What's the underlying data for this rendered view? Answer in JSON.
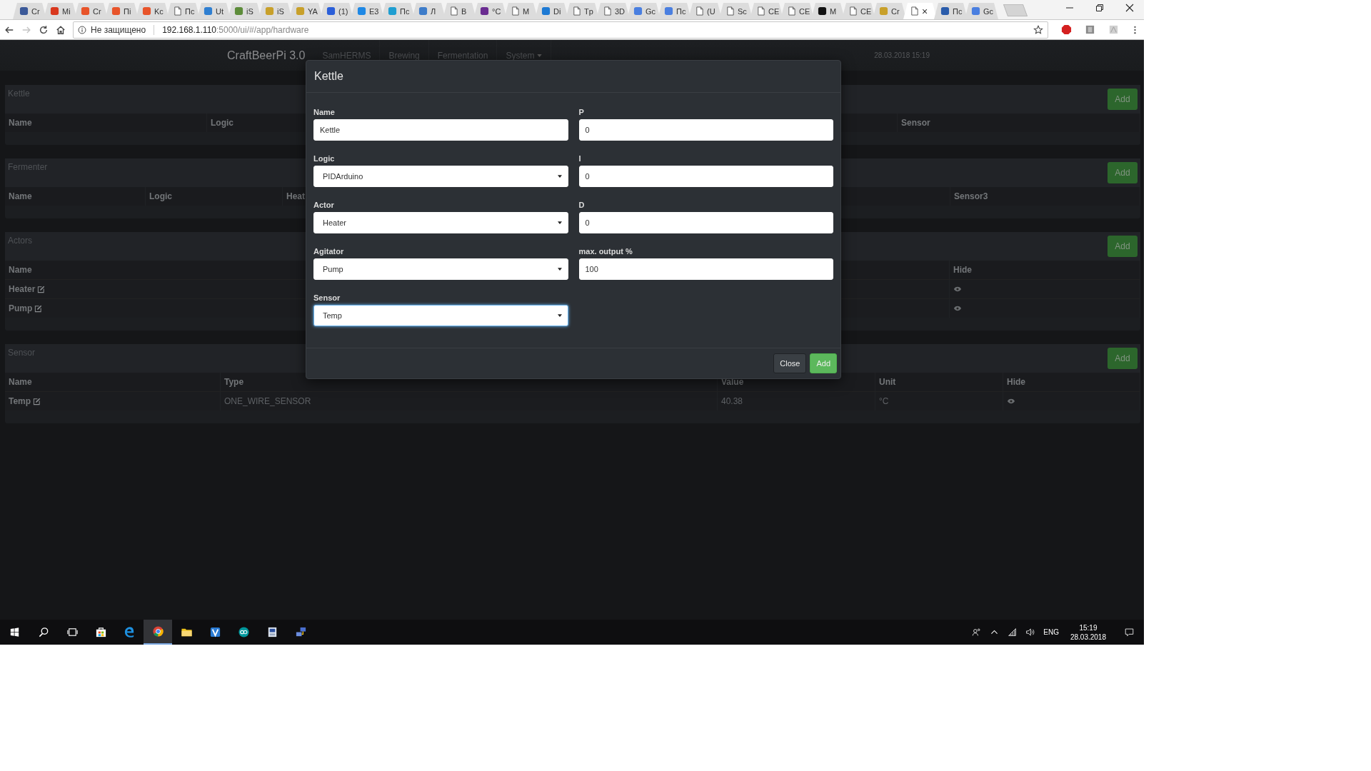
{
  "browser": {
    "tabs": [
      {
        "kind": "logo",
        "color": "#3b5998",
        "title": "Cr",
        "selected": false
      },
      {
        "kind": "logo",
        "color": "#d9381e",
        "title": "Mi",
        "selected": false
      },
      {
        "kind": "logo",
        "color": "#e8542a",
        "title": "Cr",
        "selected": false
      },
      {
        "kind": "logo",
        "color": "#e8542a",
        "title": "Пі",
        "selected": false
      },
      {
        "kind": "logo",
        "color": "#e8542a",
        "title": "Kc",
        "selected": false
      },
      {
        "kind": "doc",
        "title": "Пс",
        "selected": false
      },
      {
        "kind": "logo",
        "color": "#2f7fd1",
        "title": "Ut",
        "selected": false
      },
      {
        "kind": "logo",
        "color": "#5d8c3a",
        "title": "iS",
        "selected": false
      },
      {
        "kind": "logo",
        "color": "#c8a02a",
        "title": "iS",
        "selected": false
      },
      {
        "kind": "logo",
        "color": "#c8a02a",
        "title": "YA",
        "selected": false
      },
      {
        "kind": "logo",
        "color": "#2b5fd9",
        "title": "(1)",
        "selected": false
      },
      {
        "kind": "logo",
        "color": "#1e88e5",
        "title": "E3",
        "selected": false
      },
      {
        "kind": "logo",
        "color": "#1f9ed1",
        "title": "Пс",
        "selected": false
      },
      {
        "kind": "logo",
        "color": "#3d7cc9",
        "title": "Л",
        "selected": false
      },
      {
        "kind": "doc",
        "title": "B",
        "selected": false
      },
      {
        "kind": "logo",
        "color": "#6a2c91",
        "title": "°C",
        "selected": false
      },
      {
        "kind": "doc",
        "title": "M",
        "selected": false
      },
      {
        "kind": "logo",
        "color": "#1e7ad4",
        "title": "Di",
        "selected": false
      },
      {
        "kind": "doc",
        "title": "Tp",
        "selected": false
      },
      {
        "kind": "doc",
        "title": "3D",
        "selected": false
      },
      {
        "kind": "logo",
        "color": "#4a7fe0",
        "title": "Gc",
        "selected": false
      },
      {
        "kind": "logo",
        "color": "#4a7fe0",
        "title": "Пс",
        "selected": false
      },
      {
        "kind": "doc",
        "title": "(U",
        "selected": false
      },
      {
        "kind": "doc",
        "title": "Sc",
        "selected": false
      },
      {
        "kind": "doc",
        "title": "CE",
        "selected": false
      },
      {
        "kind": "doc",
        "title": "CE",
        "selected": false
      },
      {
        "kind": "logo",
        "color": "#111111",
        "title": "M",
        "selected": false
      },
      {
        "kind": "doc",
        "title": "CE",
        "selected": false
      },
      {
        "kind": "logo",
        "color": "#c8a02a",
        "title": "Cr",
        "selected": false
      },
      {
        "kind": "doc",
        "close": "×",
        "selected": true
      },
      {
        "kind": "logo",
        "color": "#2a5cab",
        "title": "Пс",
        "selected": false
      },
      {
        "kind": "logo",
        "color": "#4a7fe0",
        "title": "Gc",
        "selected": false
      }
    ]
  },
  "address_bar": {
    "security_label": "Не защищено",
    "url_host": "192.168.1.110",
    "url_rest": ":5000/ui/#/app/hardware",
    "forward_disabled": true
  },
  "navbar": {
    "brand": "CraftBeerPi 3.0",
    "items": [
      {
        "label": "SamHERMS",
        "dropdown": false
      },
      {
        "label": "Brewing",
        "dropdown": false
      },
      {
        "label": "Fermentation",
        "dropdown": false
      },
      {
        "label": "System",
        "dropdown": true
      }
    ],
    "datetime": "28.03.2018 15:19"
  },
  "panels": [
    {
      "title": "Kettle",
      "add_button": "Add",
      "columns": [
        "Name",
        "Logic",
        "Sensor"
      ]
    },
    {
      "title": "Fermenter",
      "add_button": "Add",
      "columns": [
        "Name",
        "Logic",
        "Heat",
        "Sensor3"
      ]
    },
    {
      "title": "Actors",
      "add_button": "Add",
      "columns": [
        "Name",
        "Hide"
      ],
      "rows": [
        {
          "cells": [
            "Heater"
          ]
        },
        {
          "cells": [
            "Pump"
          ]
        }
      ]
    },
    {
      "title": "Sensor",
      "add_button": "Add",
      "columns": [
        "Name",
        "Type",
        "Value",
        "Unit",
        "Hide"
      ],
      "rows": [
        {
          "cells": [
            "Temp",
            "ONE_WIRE_SENSOR",
            "40.38",
            "°C"
          ]
        }
      ]
    }
  ],
  "modal": {
    "title": "Kettle",
    "left_column": [
      {
        "label": "Name",
        "kind": "text",
        "value": "Kettle",
        "focused": false
      },
      {
        "label": "Logic",
        "kind": "select",
        "value": "PIDArduino",
        "focused": false
      },
      {
        "label": "Actor",
        "kind": "select",
        "value": "Heater",
        "focused": false
      },
      {
        "label": "Agitator",
        "kind": "select",
        "value": "Pump",
        "focused": false
      },
      {
        "label": "Sensor",
        "kind": "select",
        "value": "Temp",
        "focused": true
      }
    ],
    "right_column": [
      {
        "label": "P",
        "kind": "text",
        "value": "0",
        "focused": false
      },
      {
        "label": "I",
        "kind": "text",
        "value": "0",
        "focused": false
      },
      {
        "label": "D",
        "kind": "text",
        "value": "0",
        "focused": false
      },
      {
        "label": "max. output %",
        "kind": "text",
        "value": "100",
        "focused": false
      }
    ],
    "buttons": [
      {
        "label": "Close",
        "kind": "secondary"
      },
      {
        "label": "Add",
        "kind": "primary"
      }
    ]
  },
  "taskbar": {
    "apps": [
      {
        "kind": "search",
        "selected": false
      },
      {
        "kind": "taskview",
        "selected": false
      },
      {
        "kind": "store",
        "selected": false
      },
      {
        "kind": "edge",
        "selected": false
      },
      {
        "kind": "chrome",
        "selected": true
      },
      {
        "kind": "explorer",
        "selected": false
      },
      {
        "kind": "v",
        "selected": false
      },
      {
        "kind": "arduino",
        "selected": false
      },
      {
        "kind": "app",
        "selected": false
      },
      {
        "kind": "network-app",
        "selected": false
      }
    ],
    "language": "ENG",
    "time": "15:19",
    "date": "28.03.2018"
  }
}
